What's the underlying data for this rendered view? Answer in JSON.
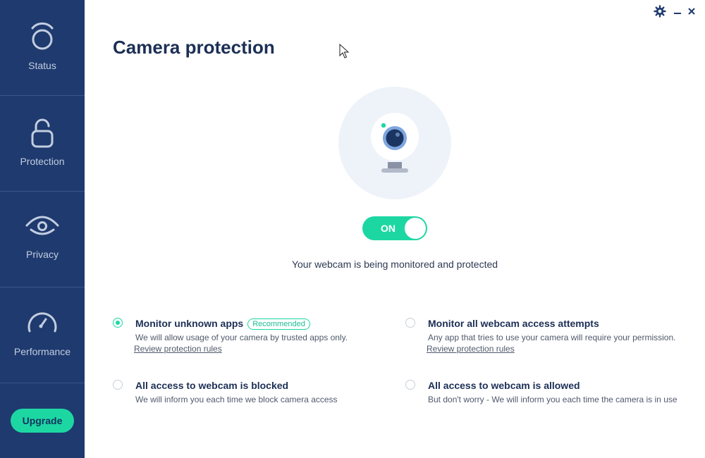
{
  "sidebar": {
    "items": [
      {
        "label": "Status",
        "icon": "status-icon"
      },
      {
        "label": "Protection",
        "icon": "lock-icon"
      },
      {
        "label": "Privacy",
        "icon": "eye-icon"
      },
      {
        "label": "Performance",
        "icon": "gauge-icon"
      }
    ],
    "upgrade_label": "Upgrade"
  },
  "window_controls": {
    "settings_icon": "gear-icon",
    "minimize_icon": "minimize-icon",
    "close_icon": "close-icon"
  },
  "main": {
    "title": "Camera protection",
    "toggle_label": "ON",
    "toggle_state": true,
    "status_text": "Your webcam is being monitored and protected",
    "options": [
      {
        "title": "Monitor unknown apps",
        "badge": "Recommended",
        "description": "We will allow usage of your camera by trusted apps only.",
        "link": "Review protection rules",
        "selected": true
      },
      {
        "title": "Monitor all webcam access attempts",
        "description": "Any app that tries to use your camera will require your permission.",
        "link": "Review protection rules",
        "selected": false
      },
      {
        "title": "All access to webcam is blocked",
        "description": "We will inform you each time we block camera access",
        "selected": false
      },
      {
        "title": "All access to webcam is allowed",
        "description": "But don't worry - We will inform you each time the camera is in use",
        "selected": false
      }
    ]
  },
  "colors": {
    "sidebar_bg": "#1e3a6e",
    "accent": "#1dd7a3",
    "title": "#1c2f55"
  }
}
